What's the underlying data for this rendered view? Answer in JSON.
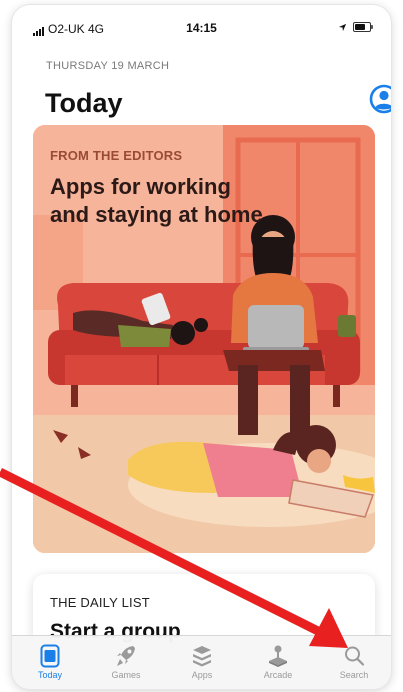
{
  "status_bar": {
    "carrier": "O2-UK 4G",
    "time": "14:15"
  },
  "header": {
    "date": "THURSDAY 19 MARCH",
    "title": "Today"
  },
  "featured_card": {
    "eyebrow": "FROM THE EDITORS",
    "headline_line1": "Apps for working",
    "headline_line2": "and staying at home",
    "illustration_icon": "home-illustration-icon"
  },
  "daily_card": {
    "eyebrow": "THE DAILY LIST",
    "title": "Start a group"
  },
  "tabs": [
    {
      "label": "Today",
      "icon": "today-icon",
      "active": true
    },
    {
      "label": "Games",
      "icon": "rocket-icon",
      "active": false
    },
    {
      "label": "Apps",
      "icon": "stack-icon",
      "active": false
    },
    {
      "label": "Arcade",
      "icon": "joystick-icon",
      "active": false
    },
    {
      "label": "Search",
      "icon": "search-icon",
      "active": false
    }
  ],
  "colors": {
    "accent": "#1a7fe8",
    "annotation_arrow": "#e8201f",
    "card_background": "#f6b49a"
  }
}
